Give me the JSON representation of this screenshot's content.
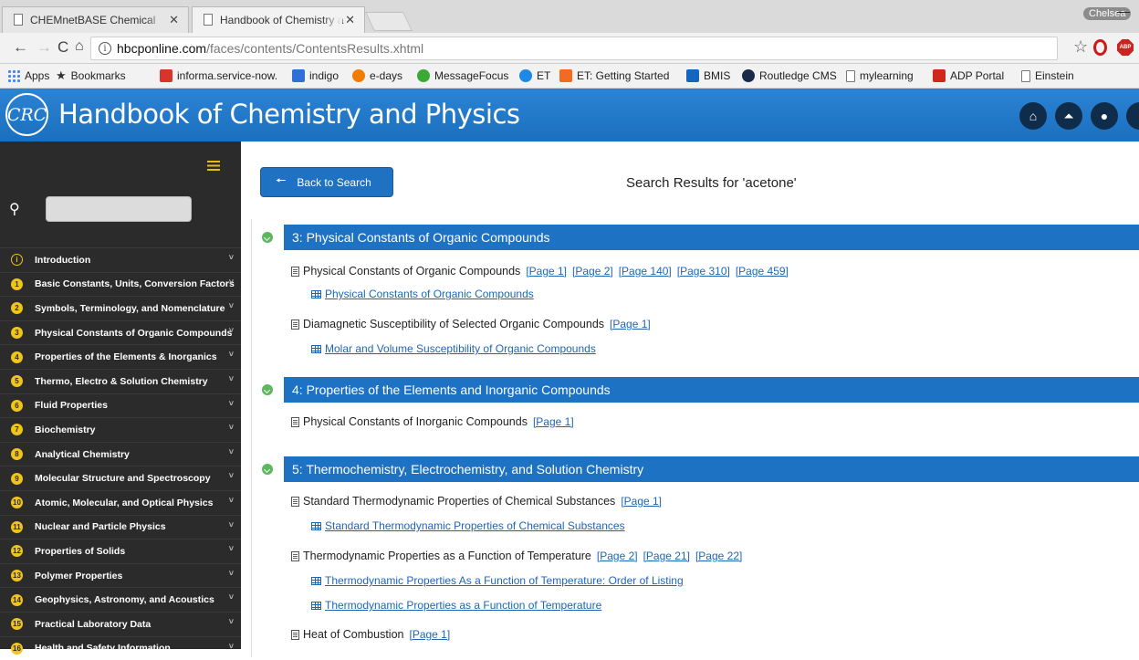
{
  "browser": {
    "tabs": [
      {
        "title": "CHEMnetBASE Chemical",
        "active": false
      },
      {
        "title": "Handbook of Chemistry a",
        "active": true
      }
    ],
    "profile": "Chelsea",
    "minimize": "—",
    "url_host": "hbcponline.com",
    "url_path": "/faces/contents/ContentsResults.xhtml",
    "bookmarks": [
      {
        "label": "Apps",
        "icon": "apps-grid-icon",
        "color": "#4285f4"
      },
      {
        "label": "Bookmarks",
        "icon": "star-icon",
        "color": "#333333"
      },
      {
        "label": "informa.service-now.",
        "icon": "servicenow-icon",
        "color": "#d9342b"
      },
      {
        "label": "indigo",
        "icon": "indigo-icon",
        "color": "#2f6fd6"
      },
      {
        "label": "e-days",
        "icon": "edays-icon",
        "color": "#f07d00"
      },
      {
        "label": "MessageFocus",
        "icon": "messagefocus-icon",
        "color": "#3aa935"
      },
      {
        "label": "ET",
        "icon": "et-icon",
        "color": "#1e88e5"
      },
      {
        "label": "ET: Getting Started",
        "icon": "et-start-icon",
        "color": "#f26b21"
      },
      {
        "label": "BMIS",
        "icon": "bmis-icon",
        "color": "#1565c0"
      },
      {
        "label": "Routledge CMS",
        "icon": "routledge-icon",
        "color": "#1a2a4a"
      },
      {
        "label": "mylearning",
        "icon": "page-icon",
        "color": "#777777"
      },
      {
        "label": "ADP Portal",
        "icon": "adp-icon",
        "color": "#d0271d"
      },
      {
        "label": "Einstein",
        "icon": "page-icon",
        "color": "#777777"
      }
    ]
  },
  "app": {
    "logo": "CRC",
    "title": "Handbook of Chemistry and Physics",
    "header_buttons": [
      "home-icon",
      "flask-icon",
      "user-icon"
    ]
  },
  "sidebar": {
    "items": [
      {
        "num": "i",
        "label": "Introduction"
      },
      {
        "num": "1",
        "label": "Basic Constants, Units, Conversion Factors"
      },
      {
        "num": "2",
        "label": "Symbols, Terminology, and Nomenclature"
      },
      {
        "num": "3",
        "label": "Physical Constants of Organic Compounds"
      },
      {
        "num": "4",
        "label": "Properties of the Elements & Inorganics"
      },
      {
        "num": "5",
        "label": "Thermo, Electro & Solution Chemistry"
      },
      {
        "num": "6",
        "label": "Fluid Properties"
      },
      {
        "num": "7",
        "label": "Biochemistry"
      },
      {
        "num": "8",
        "label": "Analytical Chemistry"
      },
      {
        "num": "9",
        "label": "Molecular Structure and Spectroscopy"
      },
      {
        "num": "10",
        "label": "Atomic, Molecular, and Optical Physics"
      },
      {
        "num": "11",
        "label": "Nuclear and Particle Physics"
      },
      {
        "num": "12",
        "label": "Properties of Solids"
      },
      {
        "num": "13",
        "label": "Polymer Properties"
      },
      {
        "num": "14",
        "label": "Geophysics, Astronomy, and Acoustics"
      },
      {
        "num": "15",
        "label": "Practical Laboratory Data"
      },
      {
        "num": "16",
        "label": "Health and Safety Information"
      }
    ]
  },
  "main": {
    "back_label": "Back to Search",
    "results_title": "Search Results for 'acetone'",
    "sections": [
      {
        "title": "3: Physical Constants of Organic Compounds",
        "entries": [
          {
            "title": "Physical Constants of Organic Compounds",
            "pages": [
              "[Page 1]",
              "[Page 2]",
              "[Page 140]",
              "[Page 310]",
              "[Page 459]"
            ],
            "tables": [
              "Physical Constants of Organic Compounds"
            ]
          },
          {
            "title": "Diamagnetic Susceptibility of Selected Organic Compounds",
            "pages": [
              "[Page 1]"
            ],
            "tables": [
              "Molar and Volume Susceptibility of Organic Compounds"
            ]
          }
        ]
      },
      {
        "title": "4: Properties of the Elements and Inorganic Compounds",
        "entries": [
          {
            "title": "Physical Constants of Inorganic Compounds",
            "pages": [
              "[Page 1]"
            ],
            "tables": []
          }
        ]
      },
      {
        "title": "5: Thermochemistry, Electrochemistry, and Solution Chemistry",
        "entries": [
          {
            "title": "Standard Thermodynamic Properties of Chemical Substances",
            "pages": [
              "[Page 1]"
            ],
            "tables": [
              "Standard Thermodynamic Properties of Chemical Substances"
            ]
          },
          {
            "title": "Thermodynamic Properties as a Function of Temperature",
            "pages": [
              "[Page 2]",
              "[Page 21]",
              "[Page 22]"
            ],
            "tables": [
              "Thermodynamic Properties As a Function of Temperature: Order of Listing",
              "Thermodynamic Properties as a Function of Temperature"
            ]
          },
          {
            "title": "Heat of Combustion",
            "pages": [
              "[Page 1]"
            ],
            "tables": []
          }
        ]
      }
    ]
  },
  "colors": {
    "header_blue": "#1d72c4",
    "sidebar_bg": "#2b2b2b",
    "accent_yellow": "#f0c419",
    "link_blue": "#1e66b5",
    "expand_green": "#5cb85c"
  }
}
